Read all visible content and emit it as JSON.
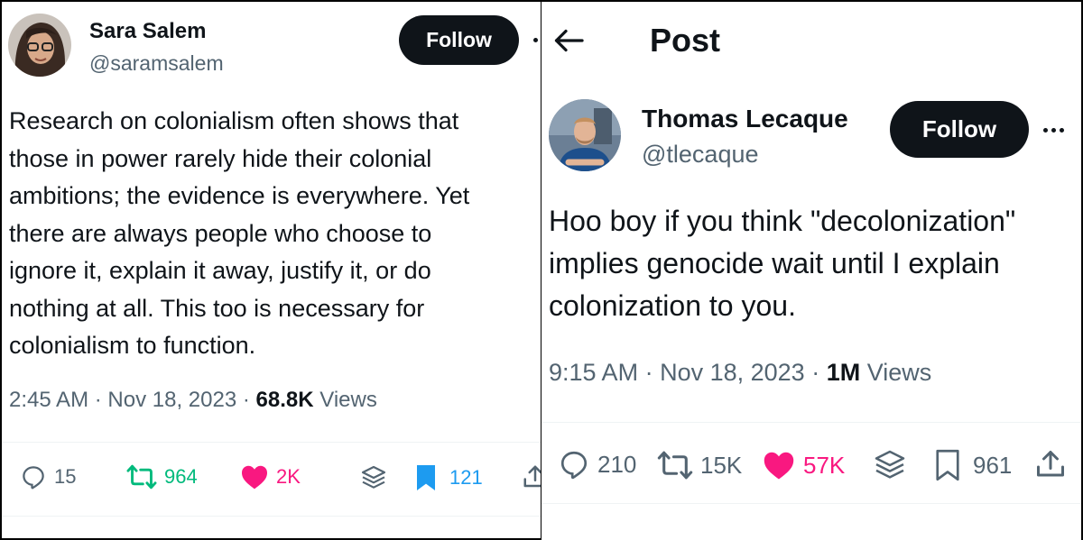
{
  "left": {
    "author": {
      "name": "Sara Salem",
      "handle": "@saramsalem"
    },
    "follow_label": "Follow",
    "text": "Research on colonialism often shows that\nthose in power rarely hide their colonial\nambitions; the evidence is everywhere. Yet\nthere are always people who choose to\nignore it, explain it away, justify it, or do\nnothing at all. This too is necessary for\ncolonialism to function.",
    "time": "2:45 AM",
    "date": "Nov 18, 2023",
    "views_count": "68.8K",
    "views_label": "Views",
    "stats": {
      "replies": "15",
      "reposts": "964",
      "likes": "2K",
      "bookmarks": "121"
    }
  },
  "right": {
    "header_title": "Post",
    "author": {
      "name": "Thomas Lecaque",
      "handle": "@tlecaque"
    },
    "follow_label": "Follow",
    "text": "Hoo boy if you think \"decolonization\"\nimplies genocide wait until I explain\ncolonization to you.",
    "time": "9:15 AM",
    "date": "Nov 18, 2023",
    "views_count": "1M",
    "views_label": "Views",
    "stats": {
      "replies": "210",
      "reposts": "15K",
      "likes": "57K",
      "bookmarks": "961"
    }
  },
  "colors": {
    "text": "#0f1419",
    "secondary": "#536471",
    "repost_active": "#00ba7c",
    "like_active": "#f91880",
    "bookmark_active": "#1d9bf0",
    "follow_bg": "#0f1419"
  },
  "icons": [
    "back-arrow-icon",
    "more-icon",
    "reply-icon",
    "repost-icon",
    "like-icon",
    "grok-icon",
    "bookmark-icon",
    "share-icon"
  ]
}
